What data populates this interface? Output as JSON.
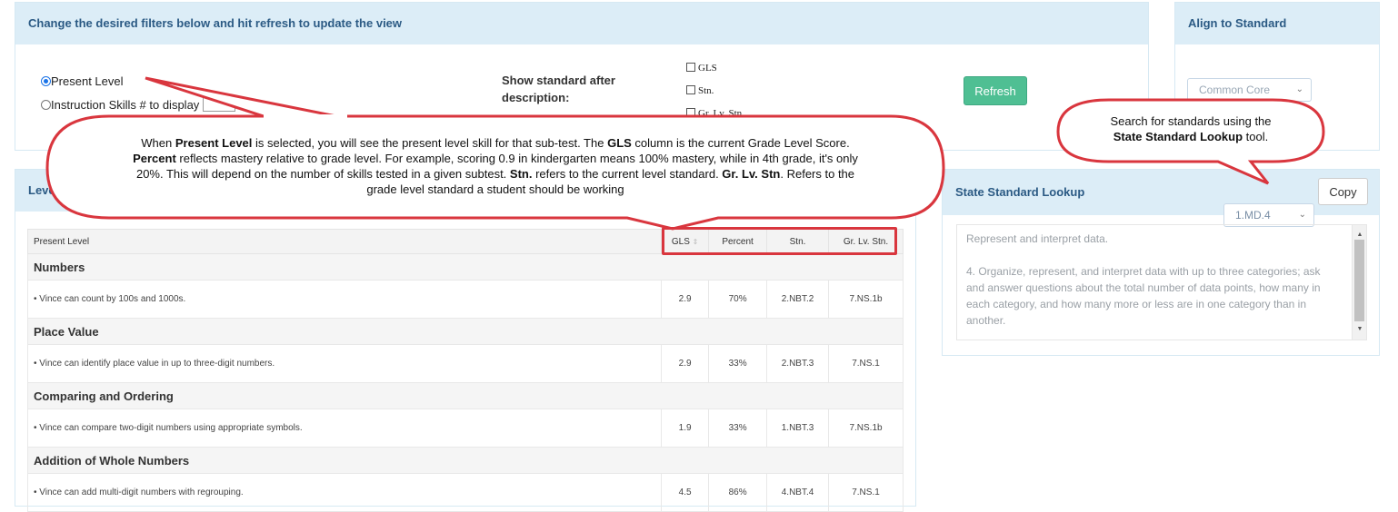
{
  "filters": {
    "header": "Change the desired filters below and hit refresh to update the view",
    "present_level_label": "Present Level",
    "instruction_skills_label": "Instruction Skills # to display",
    "show_standard_label": "Show standard after description:",
    "checkboxes": [
      "GLS",
      "Stn.",
      "Gr. Lv. Stn."
    ],
    "refresh_label": "Refresh"
  },
  "align": {
    "header": "Align to Standard",
    "select_value": "Common Core"
  },
  "levels_panel": {
    "header": "Leve"
  },
  "table": {
    "headers": [
      "Present Level",
      "GLS",
      "Percent",
      "Stn.",
      "Gr. Lv. Stn."
    ],
    "sort_icon": "sort-icon",
    "sections": [
      {
        "category": "Numbers",
        "skill": "• Vince can count by 100s and 1000s.",
        "gls": "2.9",
        "percent": "70%",
        "stn": "2.NBT.2",
        "grlv": "7.NS.1b"
      },
      {
        "category": "Place Value",
        "skill": "• Vince can identify place value in up to three-digit numbers.",
        "gls": "2.9",
        "percent": "33%",
        "stn": "2.NBT.3",
        "grlv": "7.NS.1"
      },
      {
        "category": "Comparing and Ordering",
        "skill": "• Vince can compare two-digit numbers using appropriate symbols.",
        "gls": "1.9",
        "percent": "33%",
        "stn": "1.NBT.3",
        "grlv": "7.NS.1b"
      },
      {
        "category": "Addition of Whole Numbers",
        "skill": "• Vince can add multi-digit numbers with regrouping.",
        "gls": "4.5",
        "percent": "86%",
        "stn": "4.NBT.4",
        "grlv": "7.NS.1"
      }
    ]
  },
  "lookup": {
    "header": "State Standard Lookup",
    "select_value": "1.MD.4",
    "copy_label": "Copy",
    "text_line1": "Represent and interpret data.",
    "text_line2": "4. Organize, represent, and interpret data with up to three categories; ask and answer questions about the total number of data points, how many in each category, and how many more or less are in one category than in another."
  },
  "callouts": {
    "main": {
      "p1a": "When ",
      "p1b": "Present Level",
      "p1c": " is selected, you will see the present level skill for that sub-test. The ",
      "p1d": "GLS",
      "p1e": " column is the current Grade Level Score. ",
      "p1f": "Percent",
      "p1g": " reflects mastery relative to grade level. For example, scoring 0.9 in kindergarten means 100% mastery, while in 4th grade, it's only 20%. This will depend on the number of skills tested in a given subtest. ",
      "p1h": "Stn.",
      "p1i": " refers to the current level standard. ",
      "p1j": "Gr. Lv. Stn",
      "p1k": ". Refers to the grade level standard a student should be working"
    },
    "lookup": {
      "line1": "Search for standards using the",
      "bold": "State Standard Lookup",
      "tail": " tool."
    }
  },
  "colors": {
    "header_bg": "#dcedf7",
    "header_text": "#2b5a84",
    "refresh_green": "#4fbf93",
    "callout_red": "#d9363e"
  }
}
